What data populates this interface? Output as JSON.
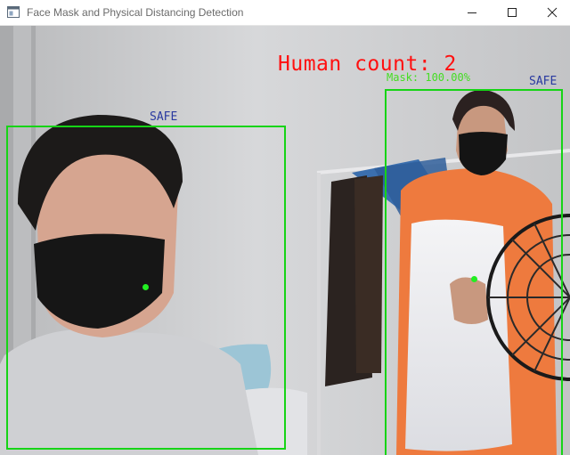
{
  "window": {
    "title": "Face Mask and Physical Distancing Detection",
    "icon": "app-window-icon",
    "controls": [
      "minimize-icon",
      "maximize-icon",
      "close-icon"
    ]
  },
  "overlay": {
    "human_count": "Human count: 2",
    "mask_confidence": "Mask: 100.00%",
    "detections": [
      {
        "status": "SAFE"
      },
      {
        "status": "SAFE"
      }
    ]
  },
  "colors": {
    "human_count": "#ff1010",
    "bounding_box": "#16d416",
    "status_text": "#2a3aa0",
    "confidence_text": "#44dd22",
    "centroid": "#22ee22"
  }
}
